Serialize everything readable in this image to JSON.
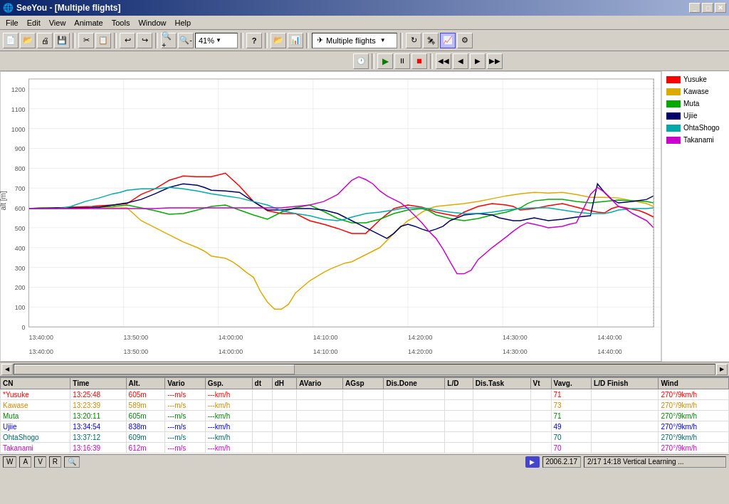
{
  "titleBar": {
    "appName": "SeeYou",
    "docName": "[Multiple flights]",
    "title": "SeeYou - [Multiple flights]"
  },
  "menu": {
    "items": [
      "File",
      "Edit",
      "View",
      "Animate",
      "Tools",
      "Window",
      "Help"
    ]
  },
  "toolbar": {
    "zoomLevel": "41%",
    "flightLabel": "Multiple flights",
    "helpTooltip": "?",
    "icons": [
      "new",
      "open",
      "print",
      "save",
      "cut",
      "copy",
      "undo",
      "redo",
      "zoom-in",
      "zoom-out"
    ]
  },
  "playback": {
    "clockLabel": "🕐",
    "playLabel": "▶",
    "pauseLabel": "⏸",
    "stopLabel": "⏹",
    "prevLabel": "◀",
    "backLabel": "◂",
    "fwdLabel": "▸",
    "nextLabel": "▶▶"
  },
  "legend": {
    "items": [
      {
        "name": "Yusuke",
        "color": "#ff0000"
      },
      {
        "name": "Kawase",
        "color": "#ddaa00"
      },
      {
        "name": "Muta",
        "color": "#00aa00"
      },
      {
        "name": "Ujiie",
        "color": "#0000ff"
      },
      {
        "name": "OhtaShogo",
        "color": "#008888"
      },
      {
        "name": "Takanami",
        "color": "#cc00cc"
      }
    ]
  },
  "chart": {
    "yAxisLabels": [
      "1200",
      "1100",
      "1000",
      "900",
      "800",
      "700",
      "600",
      "500",
      "400",
      "300",
      "200",
      "100",
      "0"
    ],
    "xAxisLabels": [
      "13:40:00",
      "13:50:00",
      "14:00:00",
      "14:10:00",
      "14:20:00",
      "14:30:00",
      "14:40:00",
      ""
    ],
    "yAxisLabel": "alt [m]"
  },
  "tableHeaders": [
    "CN",
    "Time",
    "Alt.",
    "Vario",
    "Gsp.",
    "dt",
    "dH",
    "AVario",
    "AGsp",
    "Dis.Done",
    "L/D",
    "Dis.Task",
    "Vt",
    "Vavg.",
    "L/D Finish",
    "Wind"
  ],
  "tableData": [
    {
      "cn": "*Yusuke",
      "time": "13:25:48",
      "alt": "605m",
      "vario": "---m/s",
      "gsp": "---km/h",
      "dt": "",
      "dH": "",
      "avario": "",
      "agsp": "",
      "disDone": "",
      "ld": "",
      "distask": "",
      "vt": "",
      "vavg": "71",
      "ldfinish": "",
      "wind": "270°/9km/h",
      "class": "row-yusuke"
    },
    {
      "cn": "Kawase",
      "time": "13:23:39",
      "alt": "589m",
      "vario": "---m/s",
      "gsp": "---km/h",
      "dt": "",
      "dH": "",
      "avario": "",
      "agsp": "",
      "disDone": "",
      "ld": "",
      "distask": "",
      "vt": "",
      "vavg": "73",
      "ldfinish": "",
      "wind": "270°/9km/h",
      "class": "row-kawase"
    },
    {
      "cn": "Muta",
      "time": "13:20:11",
      "alt": "605m",
      "vario": "---m/s",
      "gsp": "---km/h",
      "dt": "",
      "dH": "",
      "avario": "",
      "agsp": "",
      "disDone": "",
      "ld": "",
      "distask": "",
      "vt": "",
      "vavg": "71",
      "ldfinish": "",
      "wind": "270°/9km/h",
      "class": "row-muta"
    },
    {
      "cn": "Ujiie",
      "time": "13:34:54",
      "alt": "838m",
      "vario": "---m/s",
      "gsp": "---km/h",
      "dt": "",
      "dH": "",
      "avario": "",
      "agsp": "",
      "disDone": "",
      "ld": "",
      "distask": "",
      "vt": "",
      "vavg": "49",
      "ldfinish": "",
      "wind": "270°/9km/h",
      "class": "row-ujiie"
    },
    {
      "cn": "OhtaShogo",
      "time": "13:37:12",
      "alt": "609m",
      "vario": "---m/s",
      "gsp": "---km/h",
      "dt": "",
      "dH": "",
      "avario": "",
      "agsp": "",
      "disDone": "",
      "ld": "",
      "distask": "",
      "vt": "",
      "vavg": "70",
      "ldfinish": "",
      "wind": "270°/9km/h",
      "class": "row-ohtashogo"
    },
    {
      "cn": "Takanami",
      "time": "13:16:39",
      "alt": "612m",
      "vario": "---m/s",
      "gsp": "---km/h",
      "dt": "",
      "dH": "",
      "avario": "",
      "agsp": "",
      "disDone": "",
      "ld": "",
      "distask": "",
      "vt": "",
      "vavg": "70",
      "ldfinish": "",
      "wind": "270°/9km/h",
      "class": "row-takanami"
    }
  ],
  "statusBar": {
    "tabs": [
      "W",
      "A",
      "V",
      "R"
    ],
    "searchIcon": "🔍",
    "date": "2006.2.17",
    "dateLabel": "2/17 14:18 Vertical Learning ..."
  }
}
